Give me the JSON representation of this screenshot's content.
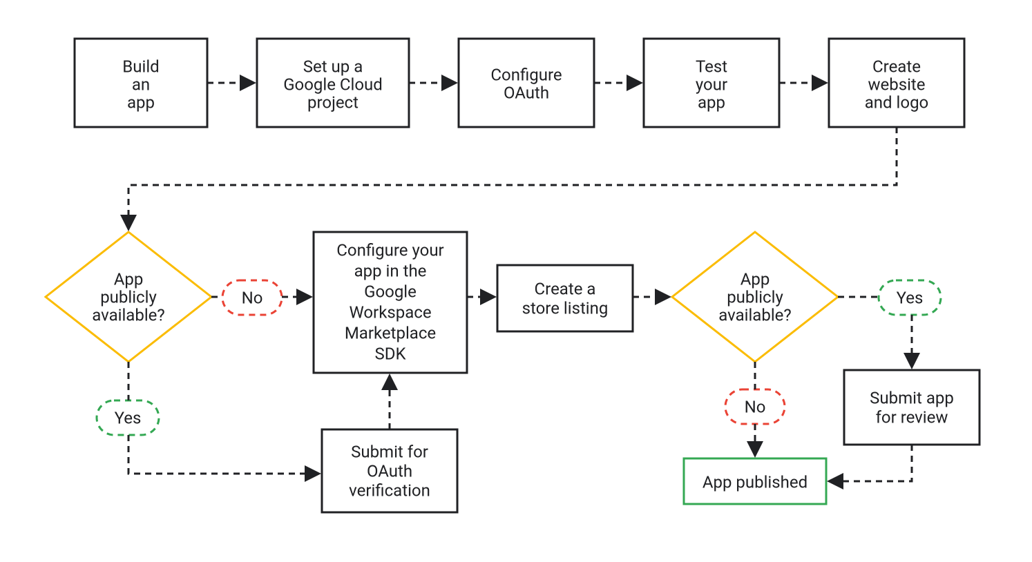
{
  "nodes": {
    "build_app": {
      "line1": "Build",
      "line2": "an",
      "line3": "app"
    },
    "setup_project": {
      "line1": "Set up a",
      "line2": "Google Cloud",
      "line3": "project"
    },
    "configure_oauth": {
      "line1": "Configure",
      "line2": "OAuth"
    },
    "test_app": {
      "line1": "Test",
      "line2": "your",
      "line3": "app"
    },
    "create_website": {
      "line1": "Create",
      "line2": "website",
      "line3": "and logo"
    },
    "decision1": {
      "line1": "App",
      "line2": "publicly",
      "line3": "available?"
    },
    "configure_sdk": {
      "line1": "Configure your",
      "line2": "app in the",
      "line3": "Google",
      "line4": "Workspace",
      "line5": "Marketplace",
      "line6": "SDK"
    },
    "store_listing": {
      "line1": "Create a",
      "line2": "store listing"
    },
    "decision2": {
      "line1": "App",
      "line2": "publicly",
      "line3": "available?"
    },
    "submit_oauth": {
      "line1": "Submit for",
      "line2": "OAuth",
      "line3": "verification"
    },
    "submit_review": {
      "line1": "Submit app",
      "line2": "for review"
    },
    "app_published": {
      "line1": "App published"
    }
  },
  "pills": {
    "yes1": "Yes",
    "no1": "No",
    "yes2": "Yes",
    "no2": "No"
  },
  "colors": {
    "border": "#202124",
    "diamond": "#fbbc04",
    "yes": "#34a853",
    "no": "#ea4335",
    "published": "#34a853"
  }
}
